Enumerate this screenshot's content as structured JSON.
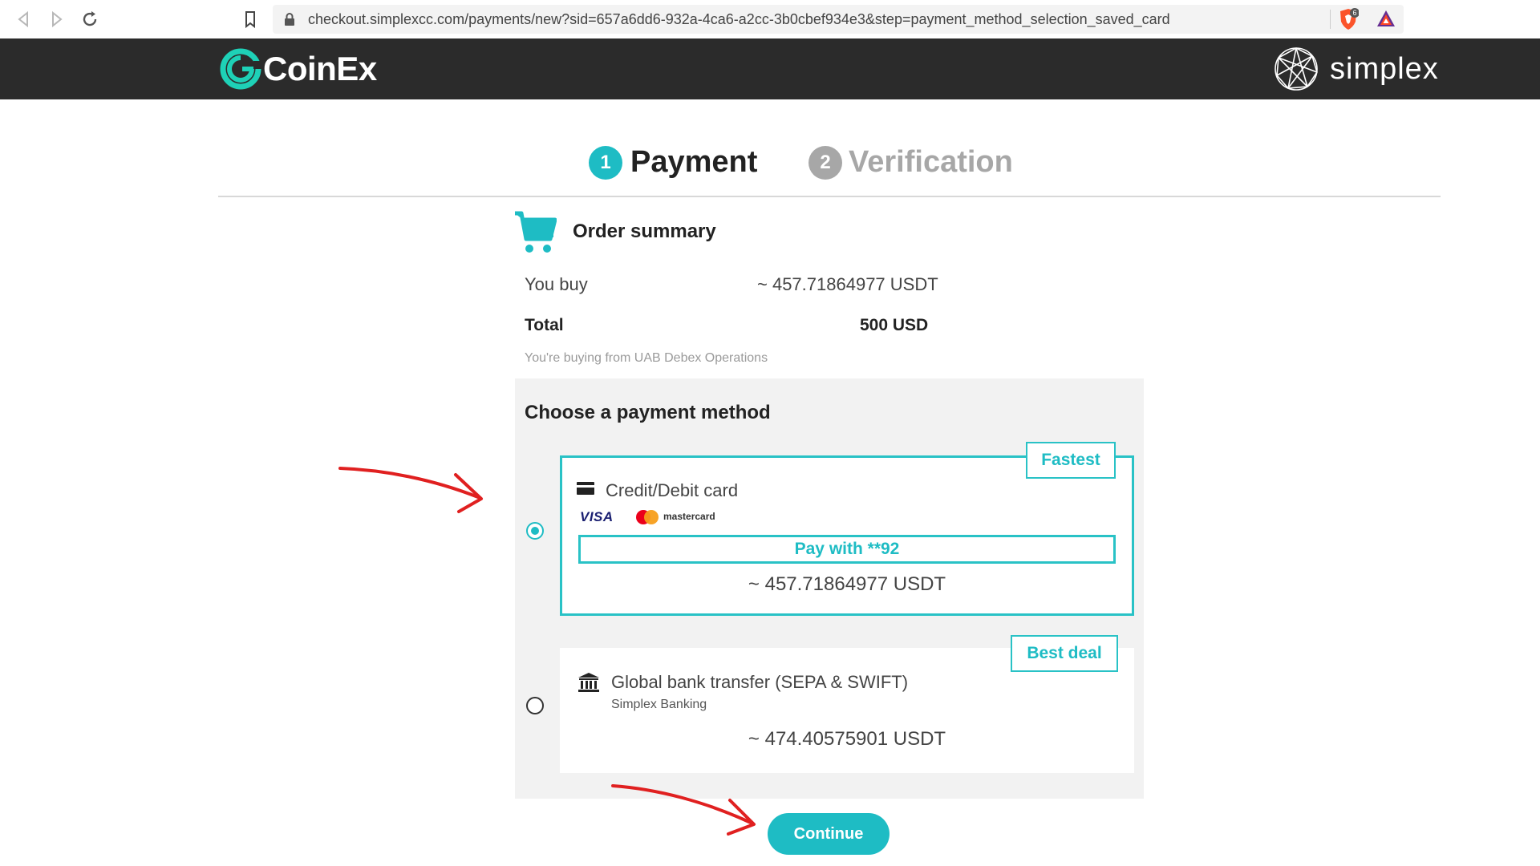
{
  "browser": {
    "url": "checkout.simplexcc.com/payments/new?sid=657a6dd6-932a-4ca6-a2cc-3b0cbef934e3&step=payment_method_selection_saved_card",
    "shield_badge_count": "6"
  },
  "header": {
    "brand_left": "CoinEx",
    "brand_right": "simplex",
    "background_color": "#2b2b2b"
  },
  "steps": [
    {
      "number": "1",
      "label": "Payment",
      "active": true
    },
    {
      "number": "2",
      "label": "Verification",
      "active": false
    }
  ],
  "order_summary": {
    "title": "Order summary",
    "you_buy_label": "You buy",
    "you_buy_value": "~ 457.71864977 USDT",
    "total_label": "Total",
    "total_value": "500 USD",
    "seller_note": "You're buying from UAB Debex Operations"
  },
  "payment_methods": {
    "title": "Choose a payment method",
    "options": [
      {
        "label": "Credit/Debit card",
        "badge": "Fastest",
        "selected": true,
        "card_brands": [
          "VISA",
          "mastercard"
        ],
        "saved_card_button": "Pay with **92",
        "amount": "~ 457.71864977 USDT"
      },
      {
        "label": "Global bank transfer (SEPA & SWIFT)",
        "sublabel": "Simplex Banking",
        "badge": "Best deal",
        "selected": false,
        "amount": "~ 474.40575901 USDT"
      }
    ]
  },
  "continue_button": "Continue",
  "colors": {
    "accent": "#1ebcc4",
    "annotation_arrow": "#e02020",
    "panel_bg": "#f2f2f2"
  }
}
